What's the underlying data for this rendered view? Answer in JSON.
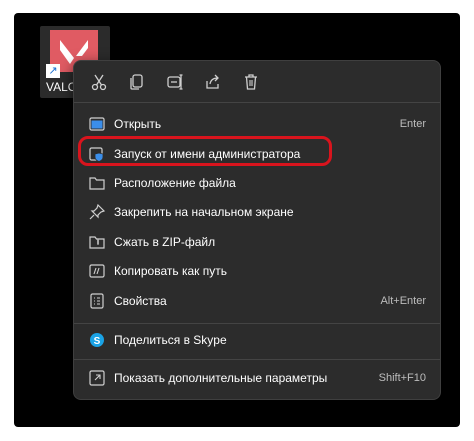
{
  "desktop": {
    "shortcut_label": "VALO",
    "app_color": "#e05b63"
  },
  "menu": {
    "toolbar": [
      {
        "icon": "scissors-icon",
        "name": "cut"
      },
      {
        "icon": "copy-icon",
        "name": "copy"
      },
      {
        "icon": "rename-icon",
        "name": "rename"
      },
      {
        "icon": "share-icon",
        "name": "share"
      },
      {
        "icon": "trash-icon",
        "name": "delete"
      }
    ],
    "items": [
      {
        "label": "Открыть",
        "shortcut": "Enter",
        "icon": "open-icon"
      },
      {
        "label": "Запуск от имени администратора",
        "shortcut": "",
        "icon": "shield-icon"
      },
      {
        "label": "Расположение файла",
        "shortcut": "",
        "icon": "folder-icon"
      },
      {
        "label": "Закрепить на начальном экране",
        "shortcut": "",
        "icon": "pin-icon"
      },
      {
        "label": "Сжать в ZIP-файл",
        "shortcut": "",
        "icon": "zip-icon"
      },
      {
        "label": "Копировать как путь",
        "shortcut": "",
        "icon": "copy-path-icon"
      },
      {
        "label": "Свойства",
        "shortcut": "Alt+Enter",
        "icon": "properties-icon"
      },
      {
        "label": "Поделиться в Skype",
        "shortcut": "",
        "icon": "skype-icon"
      },
      {
        "label": "Показать дополнительные параметры",
        "shortcut": "Shift+F10",
        "icon": "more-options-icon"
      }
    ],
    "highlight_color": "#d9141d"
  }
}
